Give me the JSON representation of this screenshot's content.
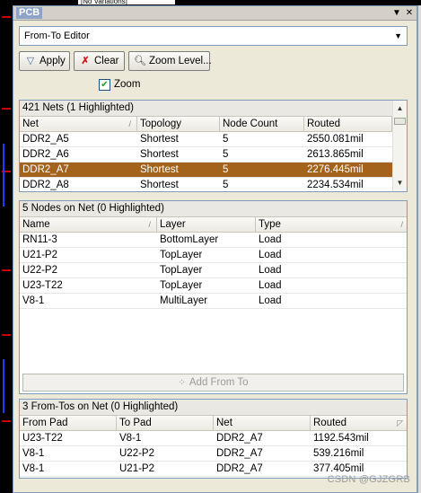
{
  "document_tab": "[No Variations]",
  "panel": {
    "title": "PCB",
    "dropdown_icon": "dropdown-arrow-icon",
    "close_icon": "close-x-icon"
  },
  "mode_select": {
    "value": "From-To Editor"
  },
  "toolbar": {
    "apply_label": "Apply",
    "clear_label": "Clear",
    "zoom_level_label": "Zoom Level..."
  },
  "zoom_checkbox": {
    "label": "Zoom",
    "checked": true
  },
  "nets": {
    "heading": "421 Nets (1 Highlighted)",
    "columns": [
      "Net",
      "Topology",
      "Node Count",
      "Routed"
    ],
    "rows": [
      {
        "net": "DDR2_A5",
        "topology": "Shortest",
        "node_count": "5",
        "routed": "2550.081mil",
        "selected": false
      },
      {
        "net": "DDR2_A6",
        "topology": "Shortest",
        "node_count": "5",
        "routed": "2613.865mil",
        "selected": false
      },
      {
        "net": "DDR2_A7",
        "topology": "Shortest",
        "node_count": "5",
        "routed": "2276.445mil",
        "selected": true
      },
      {
        "net": "DDR2_A8",
        "topology": "Shortest",
        "node_count": "5",
        "routed": "2234.534mil",
        "selected": false
      }
    ]
  },
  "nodes": {
    "heading": "5 Nodes on Net (0 Highlighted)",
    "columns": [
      "Name",
      "Layer",
      "Type"
    ],
    "rows": [
      {
        "name": "RN11-3",
        "layer": "BottomLayer",
        "type": "Load"
      },
      {
        "name": "U21-P2",
        "layer": "TopLayer",
        "type": "Load"
      },
      {
        "name": "U22-P2",
        "layer": "TopLayer",
        "type": "Load"
      },
      {
        "name": "U23-T22",
        "layer": "TopLayer",
        "type": "Load"
      },
      {
        "name": "V8-1",
        "layer": "MultiLayer",
        "type": "Load"
      }
    ],
    "add_button_label": "Add From To"
  },
  "fromtos": {
    "heading": "3 From-Tos on Net (0 Highlighted)",
    "columns": [
      "From Pad",
      "To Pad",
      "Net",
      "Routed"
    ],
    "rows": [
      {
        "from_pad": "U23-T22",
        "to_pad": "V8-1",
        "net": "DDR2_A7",
        "routed": "1192.543mil"
      },
      {
        "from_pad": "V8-1",
        "to_pad": "U22-P2",
        "net": "DDR2_A7",
        "routed": "539.216mil"
      },
      {
        "from_pad": "V8-1",
        "to_pad": "U21-P2",
        "net": "DDR2_A7",
        "routed": "377.405mil"
      }
    ]
  },
  "watermark": "CSDN @GJZGRB",
  "colors": {
    "selected_row": "#a4631c",
    "panel_bg": "#ece9d8",
    "border": "#7f9db9"
  }
}
